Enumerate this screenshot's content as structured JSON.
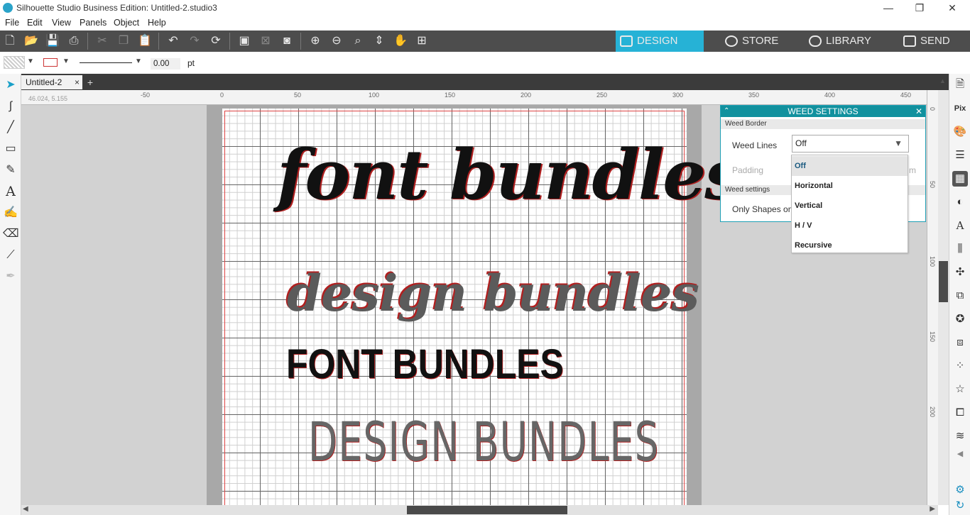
{
  "window": {
    "title": "Silhouette Studio Business Edition: Untitled-2.studio3",
    "controls": [
      "—",
      "❐",
      "✕"
    ]
  },
  "menu": [
    "File",
    "Edit",
    "View",
    "Panels",
    "Object",
    "Help"
  ],
  "nav_tabs": {
    "design": "DESIGN",
    "store": "STORE",
    "library": "LIBRARY",
    "send": "SEND",
    "active": "DESIGN"
  },
  "properties": {
    "line_width": "0.00",
    "unit": "pt"
  },
  "document_tab": {
    "name": "Untitled-2",
    "close": "×",
    "add": "+"
  },
  "ruler": {
    "coordinates": "46.024, 5.155",
    "h_ticks": [
      "-50",
      "0",
      "50",
      "100",
      "150",
      "200",
      "250",
      "300",
      "350",
      "400",
      "450"
    ],
    "v_ticks": [
      "0",
      "50",
      "100",
      "150",
      "200"
    ]
  },
  "canvas_text": {
    "line1": "font bundles",
    "line2": "design bundles",
    "line3": "FONT BUNDLES",
    "line4": "DESIGN BUNDLES"
  },
  "weed_panel": {
    "title": "WEED SETTINGS",
    "section_border": "Weed Border",
    "weed_lines_label": "Weed Lines",
    "weed_lines_value": "Off",
    "padding_label": "Padding",
    "padding_unit": "m",
    "section_settings": "Weed settings",
    "only_shapes_label": "Only Shapes on",
    "options": [
      "Off",
      "Horizontal",
      "Vertical",
      "H / V",
      "Recursive"
    ],
    "selected_option": "Off"
  },
  "colors": {
    "accent": "#26b2d6",
    "panel_header": "#11919e",
    "toolbar": "#4d4d4d",
    "cut_line": "#d44444"
  }
}
